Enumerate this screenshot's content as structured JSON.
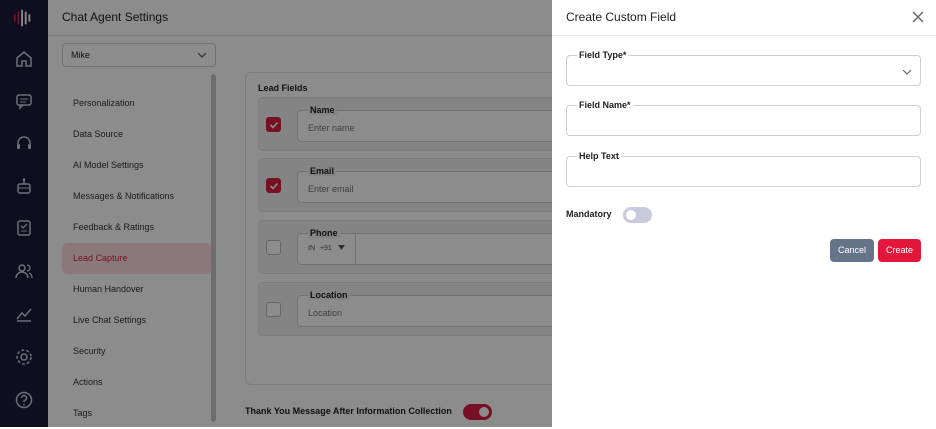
{
  "app": {
    "title": "Chat Agent Settings",
    "agent_select": "Mike"
  },
  "sidenav": {
    "items": [
      {
        "label": "Personalization"
      },
      {
        "label": "Data Source"
      },
      {
        "label": "AI Model Settings"
      },
      {
        "label": "Messages & Notifications"
      },
      {
        "label": "Feedback & Ratings"
      },
      {
        "label": "Lead Capture",
        "active": true
      },
      {
        "label": "Human Handover"
      },
      {
        "label": "Live Chat Settings"
      },
      {
        "label": "Security"
      },
      {
        "label": "Actions"
      },
      {
        "label": "Tags"
      }
    ]
  },
  "lead_fields": {
    "title": "Lead Fields",
    "fields": [
      {
        "label": "Name",
        "placeholder": "Enter name",
        "checked": true
      },
      {
        "label": "Email",
        "placeholder": "Enter email",
        "checked": true
      },
      {
        "label": "Phone",
        "country": "IN",
        "code": "+91",
        "checked": false
      },
      {
        "label": "Location",
        "placeholder": "Location",
        "checked": false
      }
    ],
    "thank_you_label": "Thank You Message After Information Collection",
    "thank_you_enabled": true
  },
  "modal": {
    "title": "Create Custom Field",
    "field_type_label": "Field Type*",
    "field_name_label": "Field Name*",
    "help_text_label": "Help Text",
    "mandatory_label": "Mandatory",
    "mandatory_enabled": false,
    "cancel_label": "Cancel",
    "create_label": "Create"
  },
  "colors": {
    "rail": "#1c1b3a",
    "accent": "#d61f3f",
    "cancel": "#657488"
  }
}
